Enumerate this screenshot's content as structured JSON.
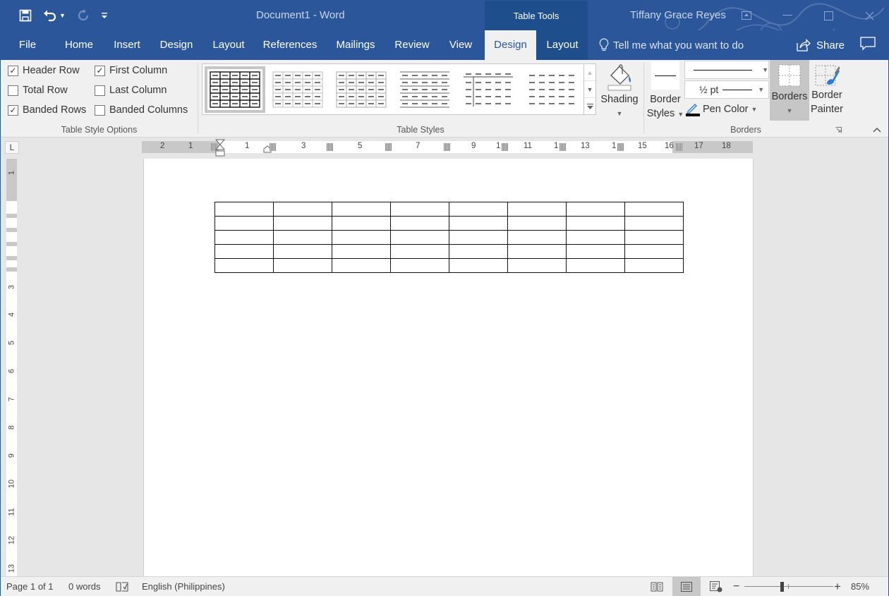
{
  "titlebar": {
    "doc_title": "Document1  -  Word",
    "context_group": "Table Tools",
    "user_name": "Tiffany Grace Reyes",
    "qat": {
      "save": "save-icon",
      "undo": "undo-icon",
      "redo": "redo-icon",
      "customize": "customize-qat-icon"
    },
    "window_controls": [
      "ribbon-display-options",
      "minimize",
      "maximize",
      "close"
    ]
  },
  "tabs": [
    {
      "label": "File"
    },
    {
      "label": "Home"
    },
    {
      "label": "Insert"
    },
    {
      "label": "Design"
    },
    {
      "label": "Layout"
    },
    {
      "label": "References"
    },
    {
      "label": "Mailings"
    },
    {
      "label": "Review"
    },
    {
      "label": "View"
    },
    {
      "label": "Design",
      "active": true,
      "contextual": true
    },
    {
      "label": "Layout",
      "contextual": true
    }
  ],
  "tellme": {
    "placeholder": "Tell me what you want to do"
  },
  "share": {
    "label": "Share"
  },
  "ribbon": {
    "table_style_options": {
      "label": "Table Style Options",
      "options": [
        {
          "label": "Header Row",
          "checked": true
        },
        {
          "label": "First Column",
          "checked": true
        },
        {
          "label": "Total Row",
          "checked": false
        },
        {
          "label": "Last Column",
          "checked": false
        },
        {
          "label": "Banded Rows",
          "checked": true
        },
        {
          "label": "Banded Columns",
          "checked": false
        }
      ]
    },
    "table_styles": {
      "label": "Table Styles",
      "gallery_count": 6,
      "selected_index": 0
    },
    "shading": {
      "label": "Shading"
    },
    "borders": {
      "label": "Borders",
      "border_styles": [
        "Border",
        "Styles"
      ],
      "line_weight": "½ pt",
      "pen_color": "Pen Color",
      "pen_color_value": "#000000",
      "borders_btn": "Borders",
      "border_painter": [
        "Border",
        "Painter"
      ]
    }
  },
  "ruler": {
    "horizontal": [
      "2",
      "1",
      "1",
      "3",
      "5",
      "7",
      "9",
      "1",
      "11",
      "1",
      "13",
      "1",
      "15",
      "16",
      "17",
      "18"
    ],
    "vertical": [
      "1",
      "3",
      "4",
      "5",
      "6",
      "7",
      "8",
      "9",
      "10",
      "11",
      "12",
      "13"
    ]
  },
  "document": {
    "table": {
      "rows": 5,
      "cols": 8
    }
  },
  "statusbar": {
    "page": "Page 1 of 1",
    "words": "0 words",
    "language": "English (Philippines)",
    "zoom": "85%",
    "zoom_percent": 85,
    "active_view": "Print Layout"
  },
  "colors": {
    "brand": "#2b579a",
    "context_tab": "#1e4e8c",
    "ribbon_bg": "#f0f0f0"
  }
}
